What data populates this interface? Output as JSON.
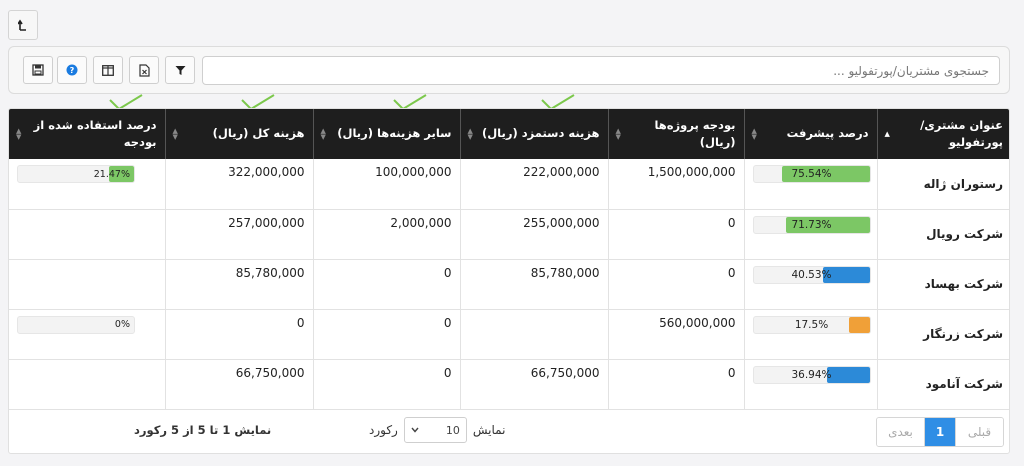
{
  "search": {
    "placeholder": "جستجوی مشتریان/پورتفولیو ..."
  },
  "icons": [
    "upload-icon",
    "save-icon",
    "help-icon",
    "columns-icon",
    "excel-icon",
    "filter-icon",
    "chevron-down-icon",
    "sort-icon",
    "checkmark-icon"
  ],
  "colors": {
    "green": "#7cc765",
    "blue": "#2c8ad8",
    "orange": "#f0a038",
    "header": "#1e1e1e",
    "check": "#7cc84c",
    "page_active": "#2f8ee5"
  },
  "table": {
    "headers": [
      "عنوان مشتری/ پورتفولیو",
      "درصد پیشرفت",
      "بودجه پروژه‌ها (ریال)",
      "هزینه دستمزد (ریال)",
      "سایر هزینه‌ها (ریال)",
      "هزینه کل (ریال)",
      "درصد استفاده شده از بودجه"
    ],
    "rows": [
      {
        "name": "رستوران ژاله",
        "progress": {
          "text": "75.54%",
          "value": 75.54,
          "color": "green"
        },
        "budget": "1,500,000,000",
        "labor": "222,000,000",
        "other": "100,000,000",
        "total": "322,000,000",
        "usage": {
          "text": "21.47%",
          "value": 21.47
        }
      },
      {
        "name": "شرکت رویال",
        "progress": {
          "text": "71.73%",
          "value": 71.73,
          "color": "green"
        },
        "budget": "0",
        "labor": "255,000,000",
        "other": "2,000,000",
        "total": "257,000,000",
        "usage": null
      },
      {
        "name": "شرکت بهساد",
        "progress": {
          "text": "40.53%",
          "value": 40.53,
          "color": "blue"
        },
        "budget": "0",
        "labor": "85,780,000",
        "other": "0",
        "total": "85,780,000",
        "usage": null
      },
      {
        "name": "شرکت زرنگار",
        "progress": {
          "text": "17.5%",
          "value": 17.5,
          "color": "orange"
        },
        "budget": "560,000,000",
        "labor": "",
        "other": "0",
        "total": "0",
        "usage": {
          "text": "0%",
          "value": 0
        }
      },
      {
        "name": "شرکت آنامود",
        "progress": {
          "text": "36.94%",
          "value": 36.94,
          "color": "blue"
        },
        "budget": "0",
        "labor": "66,750,000",
        "other": "0",
        "total": "66,750,000",
        "usage": null
      }
    ]
  },
  "footer": {
    "pagination": {
      "prev": "قبلی",
      "current": "1",
      "next": "بعدی"
    },
    "length": {
      "label_show": "نمایش",
      "value": "10",
      "label_records": "رکورد"
    },
    "info": "نمایش 1 تا 5 از 5 رکورد"
  }
}
